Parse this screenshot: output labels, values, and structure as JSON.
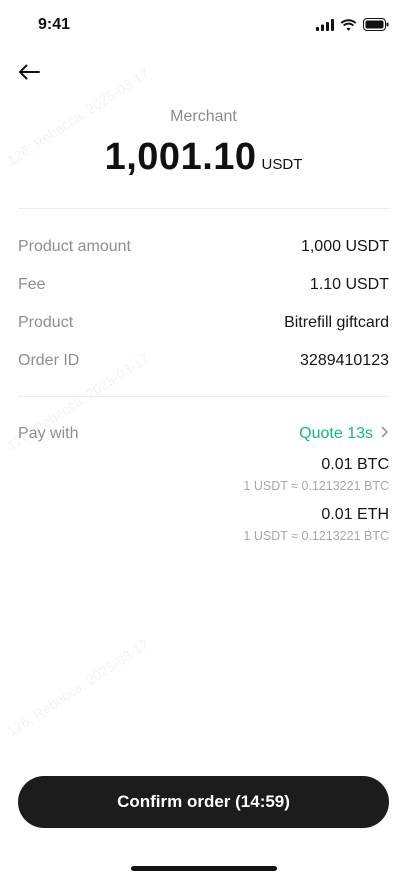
{
  "status_bar": {
    "time": "9:41"
  },
  "icons": {
    "back": "arrow-left-icon",
    "signal": "signal-icon",
    "wifi": "wifi-icon",
    "battery": "battery-icon",
    "chevron": "chevron-right-icon"
  },
  "header": {
    "merchant_label": "Merchant",
    "amount": "1,001.10",
    "currency": "USDT"
  },
  "details": [
    {
      "label": "Product amount",
      "value": "1,000 USDT"
    },
    {
      "label": "Fee",
      "value": "1.10 USDT"
    },
    {
      "label": "Product",
      "value": "Bitrefill giftcard"
    },
    {
      "label": "Order ID",
      "value": "3289410123"
    }
  ],
  "pay_with": {
    "label": "Pay with",
    "quote": "Quote 13s",
    "options": [
      {
        "amount": "0.01 BTC",
        "rate": "1 USDT ≈ 0.1213221 BTC"
      },
      {
        "amount": "0.01 ETH",
        "rate": "1 USDT ≈ 0.1213221 BTC"
      }
    ]
  },
  "watermarks": [
    "126, Rebecca, 2025-03-17",
    "126, Rebecca, 2025-03-17",
    "126, Rebecca, 2025-03-17"
  ],
  "confirm_button": {
    "label": "Confirm order (14:59)"
  },
  "colors": {
    "accent": "#12b886",
    "button_bg": "#1c1c1c",
    "muted_text": "#8e8e8e"
  }
}
